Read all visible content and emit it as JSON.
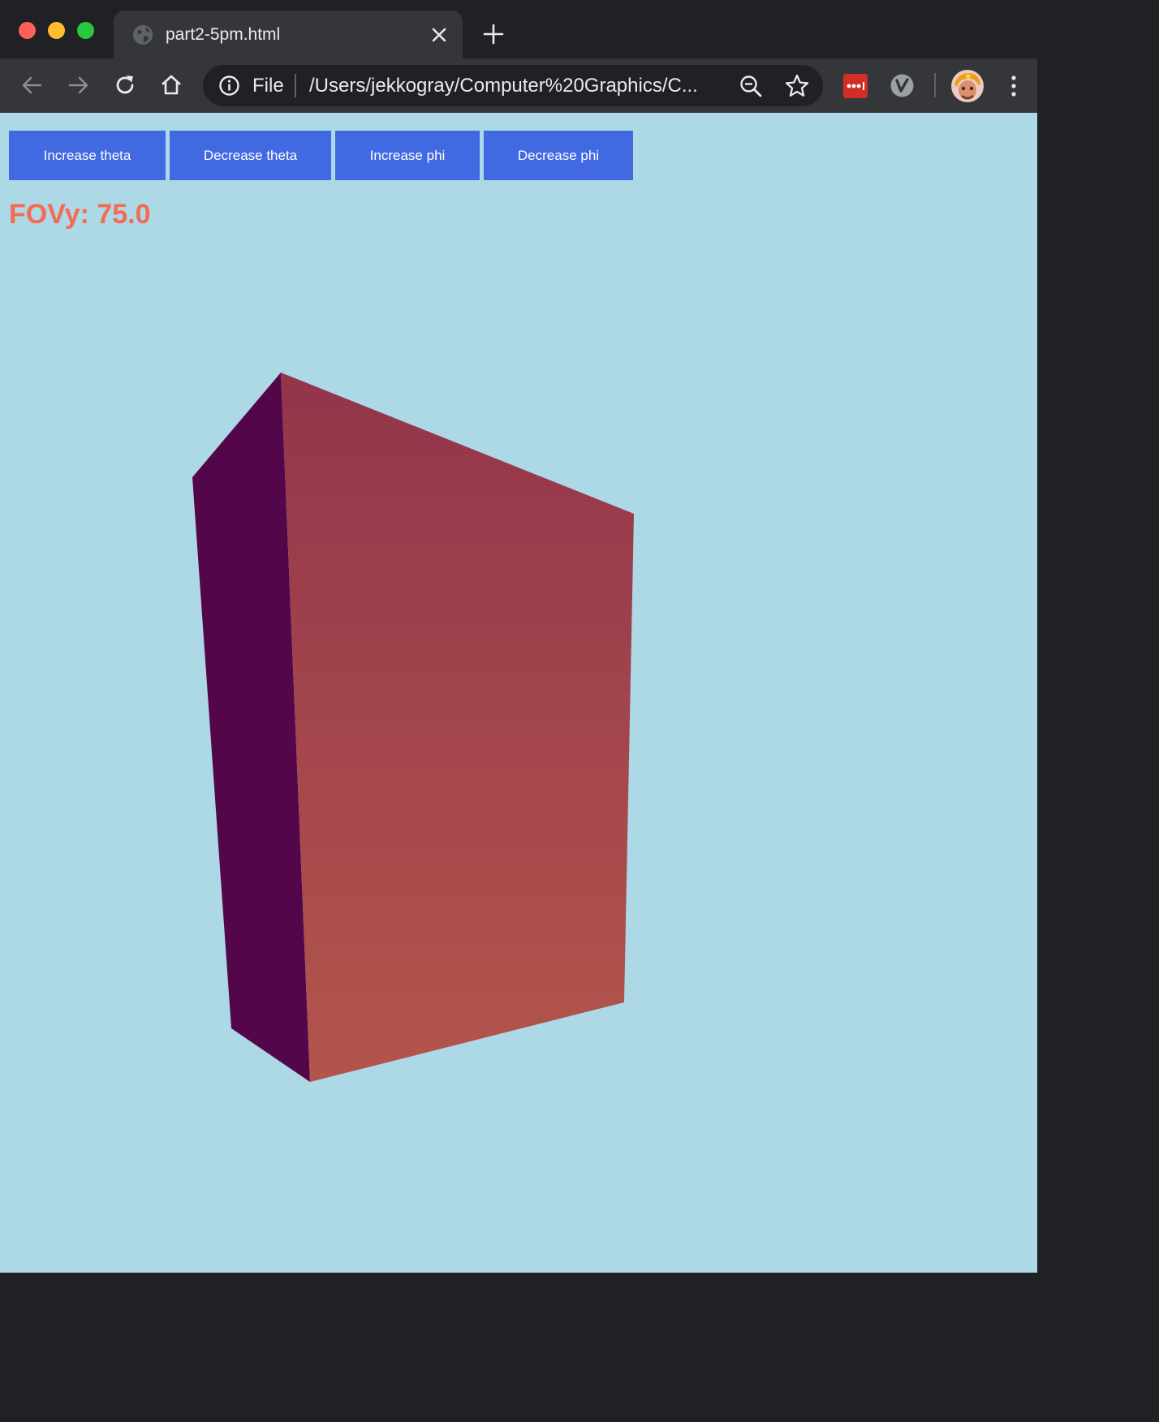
{
  "window": {
    "tab_title": "part2-5pm.html"
  },
  "toolbar": {
    "scheme_label": "File",
    "url": "/Users/jekkogray/Computer%20Graphics/C..."
  },
  "controls": {
    "increase_theta": "Increase theta",
    "decrease_theta": "Decrease theta",
    "increase_phi": "Increase phi",
    "decrease_phi": "Decrease phi"
  },
  "fovy_label": "FOVy: 75.0",
  "colors": {
    "page_background": "#add8e6",
    "button_background": "#4169e1",
    "fovy_text": "#f46b53",
    "side_face": "#53074a",
    "front_face_top": "#93354b",
    "front_face_bottom": "#b3554c"
  },
  "icons": {
    "tab_favicon": "globe-icon",
    "tab_close": "close-icon",
    "new_tab": "plus-icon",
    "back": "arrow-left-icon",
    "forward": "arrow-right-icon",
    "reload": "reload-icon",
    "home": "home-icon",
    "site_info": "info-icon",
    "zoom": "zoom-out-icon",
    "bookmark": "star-icon",
    "extension_1": "lastpass-icon",
    "extension_2": "v-extension-icon",
    "profile": "avatar",
    "menu": "kebab-menu-icon"
  }
}
